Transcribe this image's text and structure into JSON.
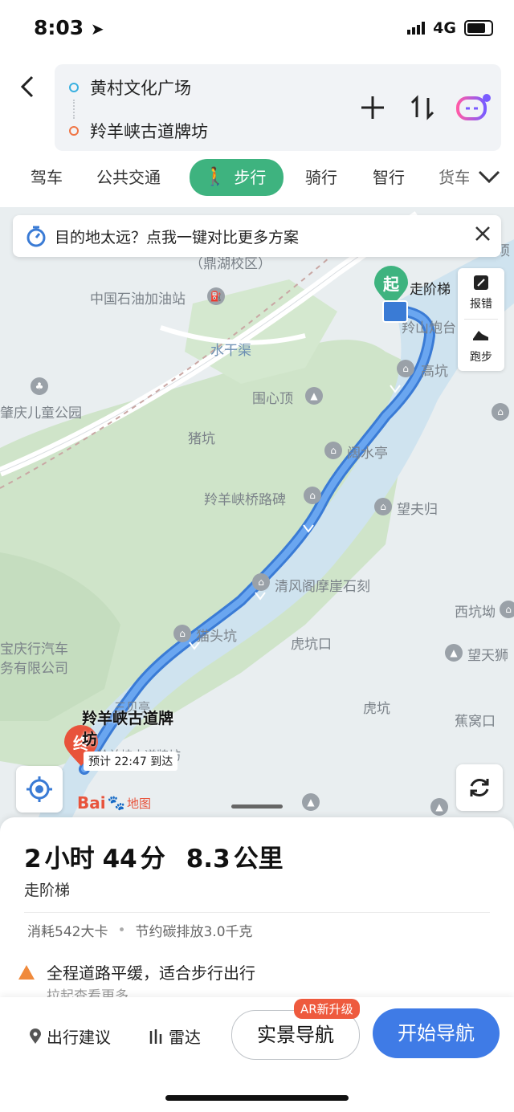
{
  "status": {
    "time": "8:03",
    "network": "4G"
  },
  "route": {
    "from": "黄村文化广场",
    "to": "羚羊峡古道牌坊"
  },
  "tabs": [
    "驾车",
    "公共交通",
    "步行",
    "骑行",
    "智行",
    "货车"
  ],
  "active_tab": "步行",
  "banner": {
    "text": "目的地太远？点我一键对比更多方案"
  },
  "side_tools": {
    "report": "报错",
    "run": "跑步"
  },
  "map": {
    "labels": {
      "school": "（鼎湖校区）",
      "gas": "中国石油加油站",
      "canal": "水干渠",
      "park": "肇庆儿童公园",
      "pit": "猪坑",
      "peak": "围心顶",
      "pavilion": "阔水亭",
      "bridge": "羚羊峡桥路碑",
      "wangfu": "望夫归",
      "qingfeng": "清风阁摩崖石刻",
      "xikeng": "西坑坳",
      "dealer_1": "宝庆行汽车",
      "dealer_2": "务有限公司",
      "maotou": "猫头坑",
      "hukengkou": "虎坑口",
      "wangtian": "望天狮",
      "hukeng": "虎坑",
      "jiaowo": "蕉窝口",
      "lingshan": "羚山炮台",
      "gao": "高坑",
      "paifang": "羚羊峡古道牌坊",
      "yiting": "三贝亭",
      "xu": "须"
    },
    "start_marker": "起",
    "start_label": "走阶梯",
    "end_marker": "终",
    "dest_title_1": "羚羊峡古道牌",
    "dest_title_2": "坊",
    "eta": "预计 22:47 到达",
    "logo": "Bai",
    "logo_suffix": "地图"
  },
  "summary": {
    "duration_hours": "2",
    "hour_unit": "小时",
    "duration_minutes": "44",
    "minute_unit": "分",
    "distance": "8.3",
    "distance_unit": "公里",
    "subtitle": "走阶梯",
    "calories": "消耗542大卡",
    "carbon": "节约碳排放3.0千克",
    "notice": "全程道路平缓，适合步行出行",
    "pull_hint": "拉起查看更多"
  },
  "actions": {
    "advice": "出行建议",
    "radar": "雷达",
    "ar_badge": "AR新升级",
    "ar_nav": "实景导航",
    "start_nav": "开始导航"
  }
}
